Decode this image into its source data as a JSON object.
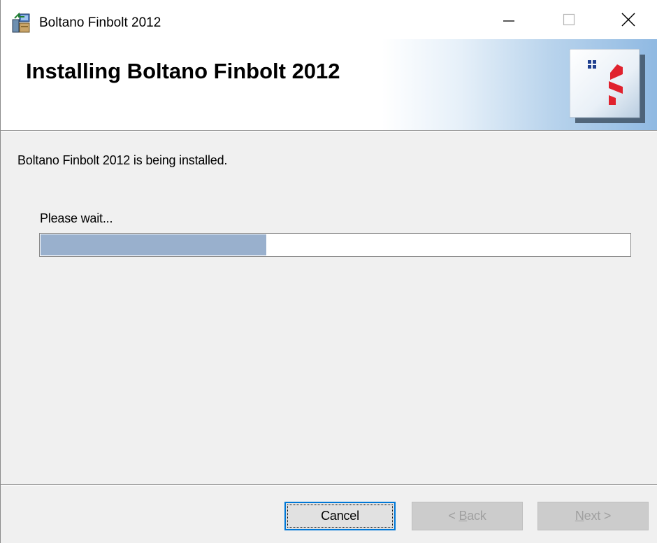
{
  "window": {
    "title": "Boltano Finbolt 2012",
    "controls": {
      "minimize": "minimize",
      "maximize": "maximize",
      "close": "close"
    }
  },
  "banner": {
    "title": "Installing Boltano Finbolt 2012",
    "logo_icon": "boltano-logo-icon",
    "gradient_end_color": "#8fb9e2"
  },
  "main": {
    "status": "Boltano Finbolt 2012 is being installed.",
    "wait_label": "Please wait...",
    "progress": {
      "fraction": 0.385,
      "fill_color": "#99b0cd"
    }
  },
  "buttons": {
    "cancel": "Cancel",
    "back_prefix": "< ",
    "back_mnemonic": "B",
    "back_rest": "ack",
    "next_mnemonic": "N",
    "next_rest": "ext >"
  }
}
